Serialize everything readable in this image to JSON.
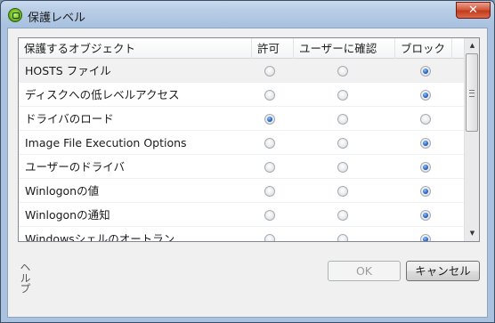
{
  "window": {
    "title": "保護レベル",
    "close_glyph": "✕"
  },
  "table": {
    "columns": [
      "保護するオブジェクト",
      "許可",
      "ユーザーに確認",
      "ブロック"
    ],
    "rows": [
      {
        "name": "HOSTS ファイル",
        "value": "block"
      },
      {
        "name": "ディスクへの低レベルアクセス",
        "value": "block"
      },
      {
        "name": "ドライバのロード",
        "value": "allow"
      },
      {
        "name": "Image File Execution Options",
        "value": "block"
      },
      {
        "name": "ユーザーのドライバ",
        "value": "block"
      },
      {
        "name": "Winlogonの値",
        "value": "block"
      },
      {
        "name": "Winlogonの通知",
        "value": "block"
      },
      {
        "name": "Windowsシェルのオートラン",
        "value": "block"
      }
    ]
  },
  "scrollbar": {
    "up_glyph": "▲",
    "down_glyph": "▼"
  },
  "footer": {
    "help_label": "ヘルプ",
    "ok_label": "OK",
    "cancel_label": "キャンセル"
  },
  "colors": {
    "selected_row": "#f1f1f1",
    "radio_checked": "#2a67c6"
  }
}
